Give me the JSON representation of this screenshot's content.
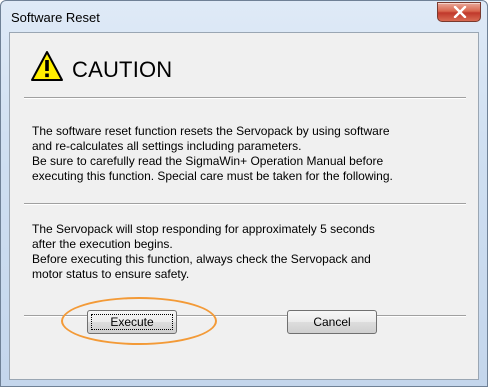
{
  "window": {
    "title": "Software Reset",
    "close_icon": "close-x-icon"
  },
  "caution": {
    "icon": "warning-triangle-icon",
    "title": "CAUTION"
  },
  "paragraph1": {
    "lines": [
      "The software reset function resets the Servopack by using software",
      "and re-calculates all settings including parameters.",
      "Be sure to carefully read the SigmaWin+ Operation Manual before",
      "executing this function. Special care must be taken for the following."
    ]
  },
  "paragraph2": {
    "lines": [
      "The Servopack will stop responding for approximately 5 seconds",
      "after  the execution begins.",
      "Before executing this function, always check the Servopack and",
      "motor status to ensure safety."
    ]
  },
  "buttons": {
    "execute_label": "Execute",
    "cancel_label": "Cancel"
  },
  "colors": {
    "highlight": "#f39a37",
    "warning_fill": "#ffef00"
  }
}
